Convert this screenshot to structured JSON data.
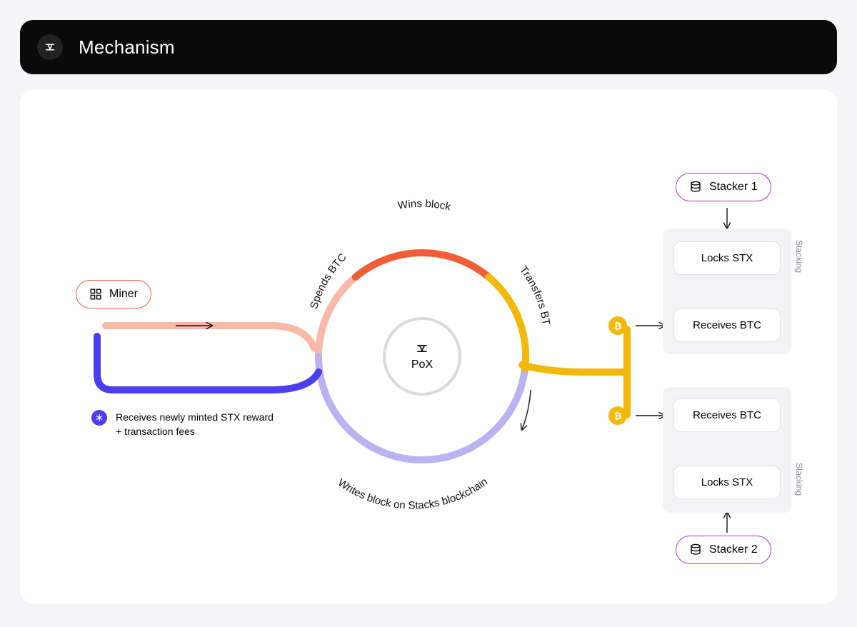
{
  "header": {
    "title": "Mechanism"
  },
  "center": {
    "label": "PoX"
  },
  "miner": {
    "label": "Miner"
  },
  "rewardNote": {
    "text": "Receives newly minted STX reward + transaction fees"
  },
  "ringLabels": {
    "spends": "Spends BTC",
    "wins": "Wins block",
    "transfers": "Transfers BTC",
    "writes": "Writes block on Stacks blockchain"
  },
  "stackers": {
    "top": {
      "label": "Stacker 1",
      "lock": "Locks STX",
      "recv": "Receives BTC",
      "panelLabel": "Stacking"
    },
    "bottom": {
      "label": "Stacker 2",
      "lock": "Locks STX",
      "recv": "Receives BTC",
      "panelLabel": "Stacking"
    }
  },
  "colors": {
    "orange": "#f25d36",
    "peach": "#f8b9a9",
    "amber": "#f2b90c",
    "violet": "#4b3df0",
    "lilac": "#b9b3f2",
    "magenta": "#b035cf"
  }
}
